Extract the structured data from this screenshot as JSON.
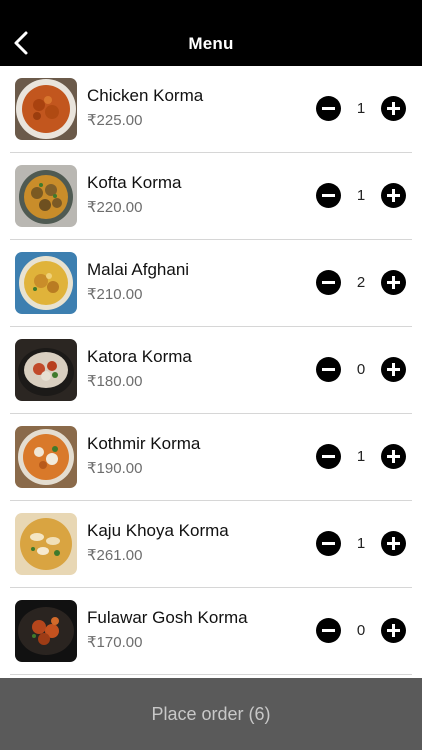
{
  "header": {
    "title": "Menu",
    "back_icon": "chevron-left-icon"
  },
  "menu_items": [
    {
      "name": "Chicken Korma",
      "price": "₹225.00",
      "quantity": "1"
    },
    {
      "name": "Kofta Korma",
      "price": "₹220.00",
      "quantity": "1"
    },
    {
      "name": "Malai Afghani",
      "price": "₹210.00",
      "quantity": "2"
    },
    {
      "name": "Katora Korma",
      "price": "₹180.00",
      "quantity": "0"
    },
    {
      "name": "Kothmir Korma",
      "price": "₹190.00",
      "quantity": "1"
    },
    {
      "name": "Kaju Khoya Korma",
      "price": "₹261.00",
      "quantity": "1"
    },
    {
      "name": "Fulawar Gosh Korma",
      "price": "₹170.00",
      "quantity": "0"
    }
  ],
  "footer": {
    "place_order_label": "Place order (6)"
  },
  "colors": {
    "header_bg": "#000000",
    "footer_bg": "#5a5a5a",
    "footer_text": "#c8c8c8",
    "price_text": "#6d6d6d"
  }
}
